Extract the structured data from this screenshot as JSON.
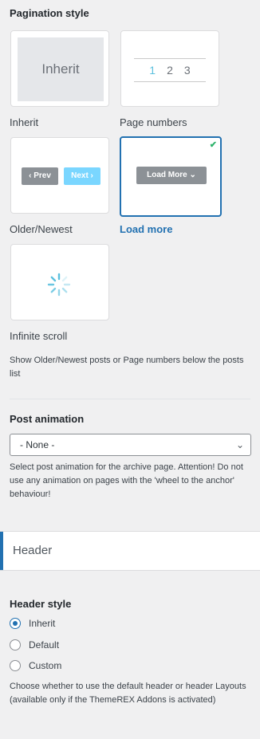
{
  "pagination": {
    "title": "Pagination style",
    "options": [
      {
        "id": "inherit",
        "label": "Inherit",
        "preview_text": "Inherit"
      },
      {
        "id": "page-numbers",
        "label": "Page numbers",
        "preview_numbers": [
          "1",
          "2",
          "3"
        ]
      },
      {
        "id": "older-newest",
        "label": "Older/Newest",
        "prev_label": "‹ Prev",
        "next_label": "Next ›"
      },
      {
        "id": "load-more",
        "label": "Load more",
        "button_label": "Load More ⌄",
        "selected": true
      },
      {
        "id": "infinite-scroll",
        "label": "Infinite scroll"
      }
    ],
    "help": "Show Older/Newest posts or Page numbers below the posts list"
  },
  "post_animation": {
    "title": "Post animation",
    "selected": "- None -",
    "help": "Select post animation for the archive page. Attention! Do not use any animation on pages with the 'wheel to the anchor' behaviour!"
  },
  "header_section": {
    "title": "Header"
  },
  "header_style": {
    "title": "Header style",
    "options": [
      {
        "label": "Inherit",
        "checked": true
      },
      {
        "label": "Default",
        "checked": false
      },
      {
        "label": "Custom",
        "checked": false
      }
    ],
    "help": "Choose whether to use the default header or header Layouts (available only if the ThemeREX Addons is activated)"
  },
  "colors": {
    "accent": "#2271b1",
    "check": "#2eb36b",
    "spinner": "#5bc0de"
  }
}
